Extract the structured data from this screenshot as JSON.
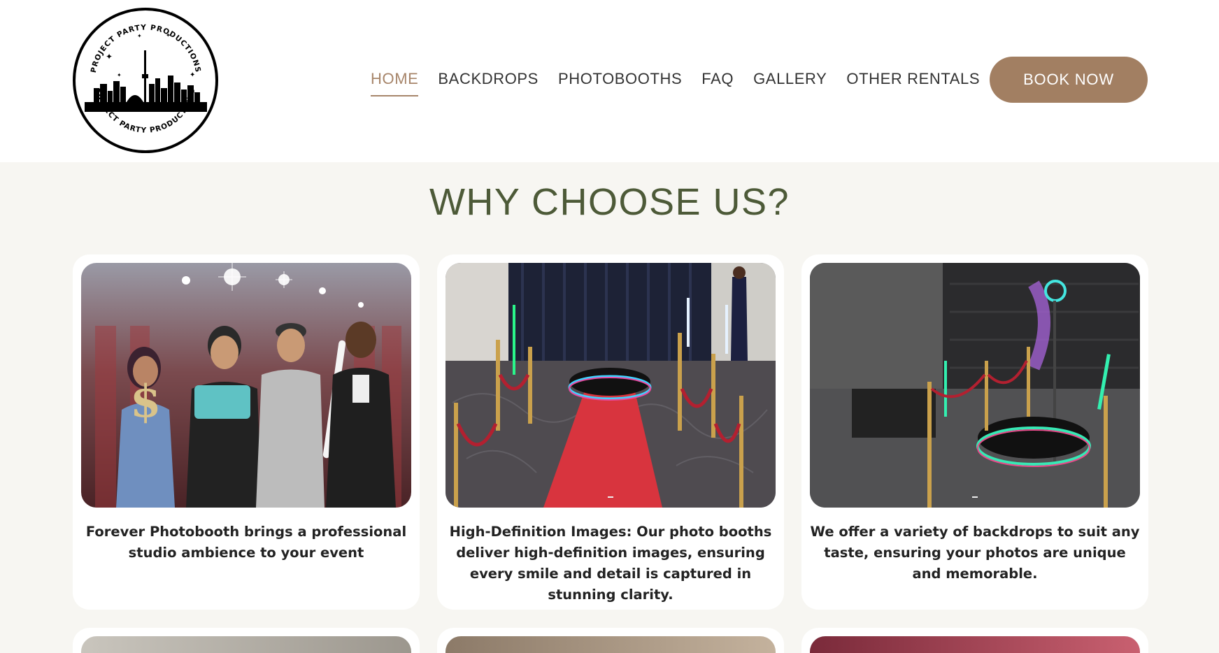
{
  "header": {
    "logo": {
      "top_text": "PROJECT PARTY PRODUCTIONS",
      "bottom_text": "PROJECT PARTY PRODUCTIONS"
    },
    "nav": [
      {
        "label": "HOME",
        "active": true
      },
      {
        "label": "BACKDROPS",
        "active": false
      },
      {
        "label": "PHOTOBOOTHS",
        "active": false
      },
      {
        "label": "FAQ",
        "active": false
      },
      {
        "label": "GALLERY",
        "active": false
      },
      {
        "label": "OTHER RENTALS",
        "active": false
      }
    ],
    "book_button": "BOOK NOW"
  },
  "section": {
    "title": "WHY CHOOSE US?",
    "cards": [
      {
        "text": "Forever Photobooth brings a professional studio ambience to your event",
        "image": "group-photo-booth-guests"
      },
      {
        "text": "High-Definition Images: Our photo booths deliver high-definition images, ensuring every smile and detail is captured in stunning clarity.",
        "image": "360-booth-red-carpet"
      },
      {
        "text": "We offer a variety of backdrops to suit any taste, ensuring your photos are unique and memorable.",
        "image": "360-booth-dark-venue"
      }
    ]
  },
  "colors": {
    "accent": "#a7856a",
    "button": "#a27f62",
    "title": "#4d5a38",
    "background": "#f7f6f2"
  }
}
